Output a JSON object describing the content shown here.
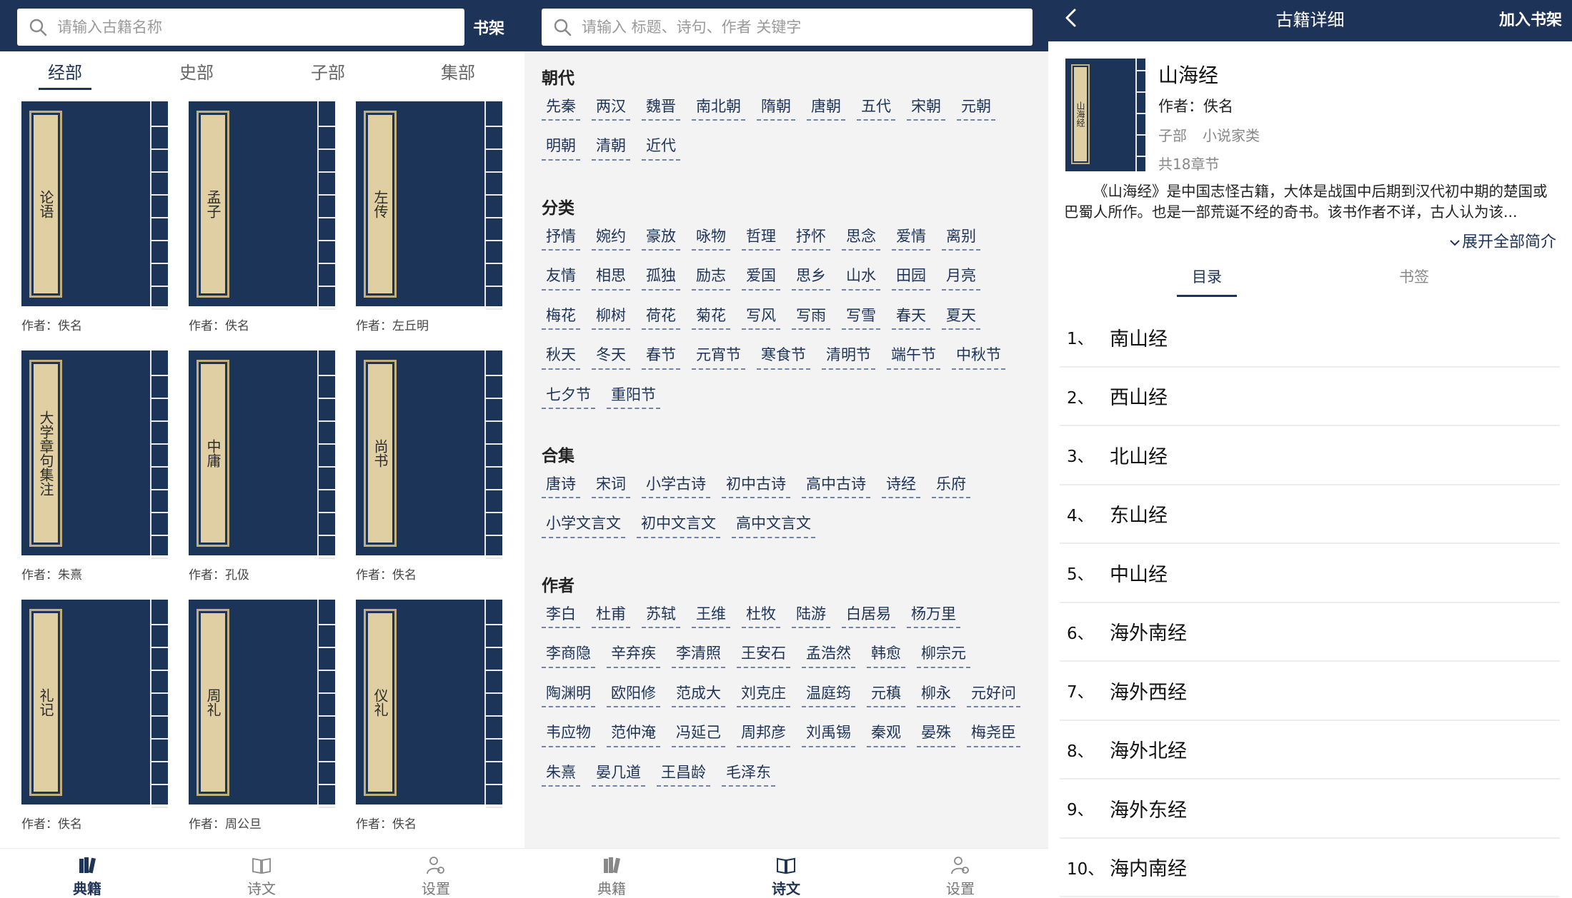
{
  "panel1": {
    "search_placeholder": "请输入古籍名称",
    "shelf_label": "书架",
    "tabs": [
      "经部",
      "史部",
      "子部",
      "集部"
    ],
    "books": [
      {
        "title": "论语",
        "author_prefix": "作者：",
        "author": "佚名"
      },
      {
        "title": "孟子",
        "author_prefix": "作者：",
        "author": "佚名"
      },
      {
        "title": "左传",
        "author_prefix": "作者：",
        "author": "左丘明"
      },
      {
        "title": "大学章句集注",
        "author_prefix": "作者：",
        "author": "朱熹"
      },
      {
        "title": "中庸",
        "author_prefix": "作者：",
        "author": "孔伋"
      },
      {
        "title": "尚书",
        "author_prefix": "作者：",
        "author": "佚名"
      },
      {
        "title": "礼记",
        "author_prefix": "作者：",
        "author": "佚名"
      },
      {
        "title": "周礼",
        "author_prefix": "作者：",
        "author": "周公旦"
      },
      {
        "title": "仪礼",
        "author_prefix": "作者：",
        "author": "佚名"
      }
    ]
  },
  "nav": {
    "classics": "典籍",
    "poems": "诗文",
    "settings": "设置"
  },
  "panel2": {
    "search_placeholder": "请输入 标题、诗句、作者 关键字",
    "sections": [
      {
        "title": "朝代",
        "tags": [
          "先秦",
          "两汉",
          "魏晋",
          "南北朝",
          "隋朝",
          "唐朝",
          "五代",
          "宋朝",
          "元朝",
          "明朝",
          "清朝",
          "近代"
        ]
      },
      {
        "title": "分类",
        "tags": [
          "抒情",
          "婉约",
          "豪放",
          "咏物",
          "哲理",
          "抒怀",
          "思念",
          "爱情",
          "离别",
          "友情",
          "相思",
          "孤独",
          "励志",
          "爱国",
          "思乡",
          "山水",
          "田园",
          "月亮",
          "梅花",
          "柳树",
          "荷花",
          "菊花",
          "写风",
          "写雨",
          "写雪",
          "春天",
          "夏天",
          "秋天",
          "冬天",
          "春节",
          "元宵节",
          "寒食节",
          "清明节",
          "端午节",
          "中秋节",
          "七夕节",
          "重阳节"
        ]
      },
      {
        "title": "合集",
        "tags": [
          "唐诗",
          "宋词",
          "小学古诗",
          "初中古诗",
          "高中古诗",
          "诗经",
          "乐府",
          "小学文言文",
          "初中文言文",
          "高中文言文"
        ]
      },
      {
        "title": "作者",
        "tags": [
          "李白",
          "杜甫",
          "苏轼",
          "王维",
          "杜牧",
          "陆游",
          "白居易",
          "杨万里",
          "李商隐",
          "辛弃疾",
          "李清照",
          "王安石",
          "孟浩然",
          "韩愈",
          "柳宗元",
          "陶渊明",
          "欧阳修",
          "范成大",
          "刘克庄",
          "温庭筠",
          "元稹",
          "柳永",
          "元好问",
          "韦应物",
          "范仲淹",
          "冯延己",
          "周邦彦",
          "刘禹锡",
          "秦观",
          "晏殊",
          "梅尧臣",
          "朱熹",
          "晏几道",
          "王昌龄",
          "毛泽东"
        ]
      }
    ]
  },
  "panel3": {
    "title": "古籍详细",
    "add_shelf": "加入书架",
    "cover_label": "山海经",
    "book_name": "山海经",
    "author_line": "作者：佚名",
    "category": "子部",
    "subcategory": "小说家类",
    "chapters_count": "共18章节",
    "intro": "《山海经》是中国志怪古籍，大体是战国中后期到汉代初中期的楚国或巴蜀人所作。也是一部荒诞不经的奇书。该书作者不详，古人认为该...",
    "expand": "展开全部简介",
    "tabs": [
      "目录",
      "书签"
    ],
    "chapters": [
      {
        "num": "1、",
        "title": "南山经"
      },
      {
        "num": "2、",
        "title": "西山经"
      },
      {
        "num": "3、",
        "title": "北山经"
      },
      {
        "num": "4、",
        "title": "东山经"
      },
      {
        "num": "5、",
        "title": "中山经"
      },
      {
        "num": "6、",
        "title": "海外南经"
      },
      {
        "num": "7、",
        "title": "海外西经"
      },
      {
        "num": "8、",
        "title": "海外北经"
      },
      {
        "num": "9、",
        "title": "海外东经"
      },
      {
        "num": "10、",
        "title": "海内南经"
      }
    ]
  },
  "colors": {
    "primary": "#1d3357",
    "cover": "#1d3459",
    "label": "#e0cfa2"
  }
}
